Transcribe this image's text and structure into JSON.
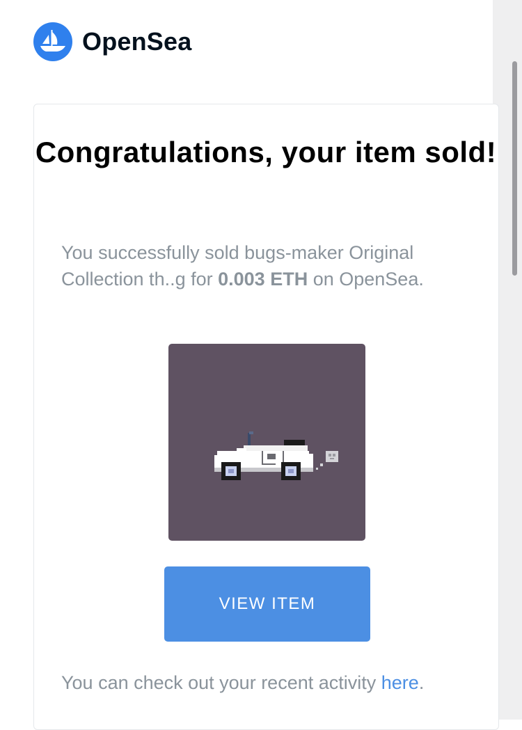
{
  "brand": {
    "name": "OpenSea",
    "logo_icon": "opensea-ship-icon",
    "logo_color": "#2f80ed"
  },
  "email": {
    "title": "Congratulations, your item sold!",
    "message_prefix": "You successfully sold bugs-maker Original Collection th..g for ",
    "price": "0.003 ETH",
    "message_suffix": " on OpenSea.",
    "nft_image": "pixel-art-white-convertible-car",
    "nft_background": "#5f5262",
    "button_label": "VIEW ITEM",
    "button_color": "#4c8fe3",
    "footer_prefix": "You can check out your recent activity ",
    "footer_link": "here",
    "footer_suffix": "."
  }
}
